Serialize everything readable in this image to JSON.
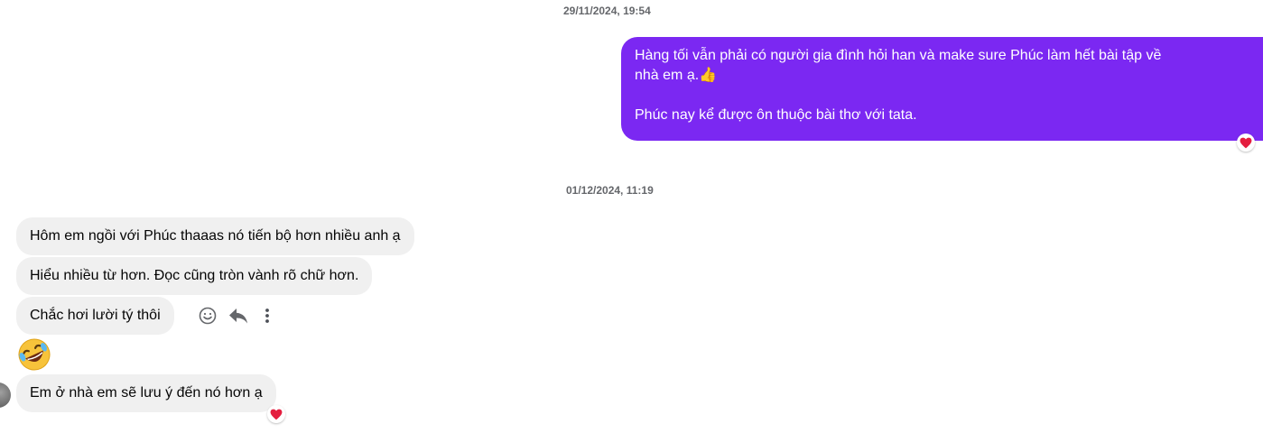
{
  "conversation": {
    "timestamps": [
      "29/11/2024, 19:54",
      "01/12/2024, 11:19"
    ],
    "outgoing": {
      "lines": [
        "Hàng tối vẫn phải có người gia đình hỏi han và make sure Phúc làm hết bài tập về",
        "nhà em ạ.👍",
        "Phúc nay kể được ôn thuộc bài thơ với tata."
      ],
      "reaction": "heart"
    },
    "incoming": [
      {
        "text": "Hôm em ngồi với Phúc thaaas nó tiến bộ hơn nhiều anh ạ"
      },
      {
        "text": "Hiểu nhiều từ hơn. Đọc cũng tròn vành rõ chữ hơn."
      },
      {
        "text": "Chắc hơi lười tý thôi"
      },
      {
        "emoji": "rolling-on-floor-laughing"
      },
      {
        "text": "Em ở nhà em sẽ lưu ý đến nó hơn ạ",
        "reaction": "heart"
      }
    ],
    "hover_actions": [
      "react-icon",
      "reply-icon",
      "more-options-icon"
    ]
  },
  "colors": {
    "outgoing_bubble": "#7b28f2",
    "incoming_bubble": "#f0f0f0",
    "timestamp_text": "#65676b",
    "reaction_heart": "#e41e3f"
  }
}
